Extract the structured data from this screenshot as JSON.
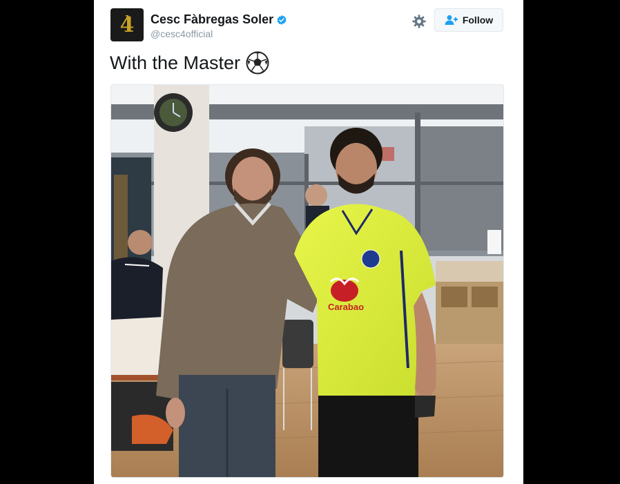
{
  "tweet": {
    "author": {
      "display_name": "Cesc Fàbregas Soler",
      "handle": "@cesc4official",
      "avatar_glyph": "4̀",
      "verified": true
    },
    "follow_label": "Follow",
    "text": "With the Master",
    "emoji_icon": "soccer-ball-icon",
    "photo": {
      "jersey_sponsor": "Carabao"
    }
  },
  "colors": {
    "accent": "#1da1f2",
    "text": "#14171a",
    "muted": "#8899a6",
    "jersey": "#e0f044"
  },
  "icons": [
    "verified-badge-icon",
    "gear-icon",
    "follow-user-icon",
    "soccer-ball-icon"
  ]
}
